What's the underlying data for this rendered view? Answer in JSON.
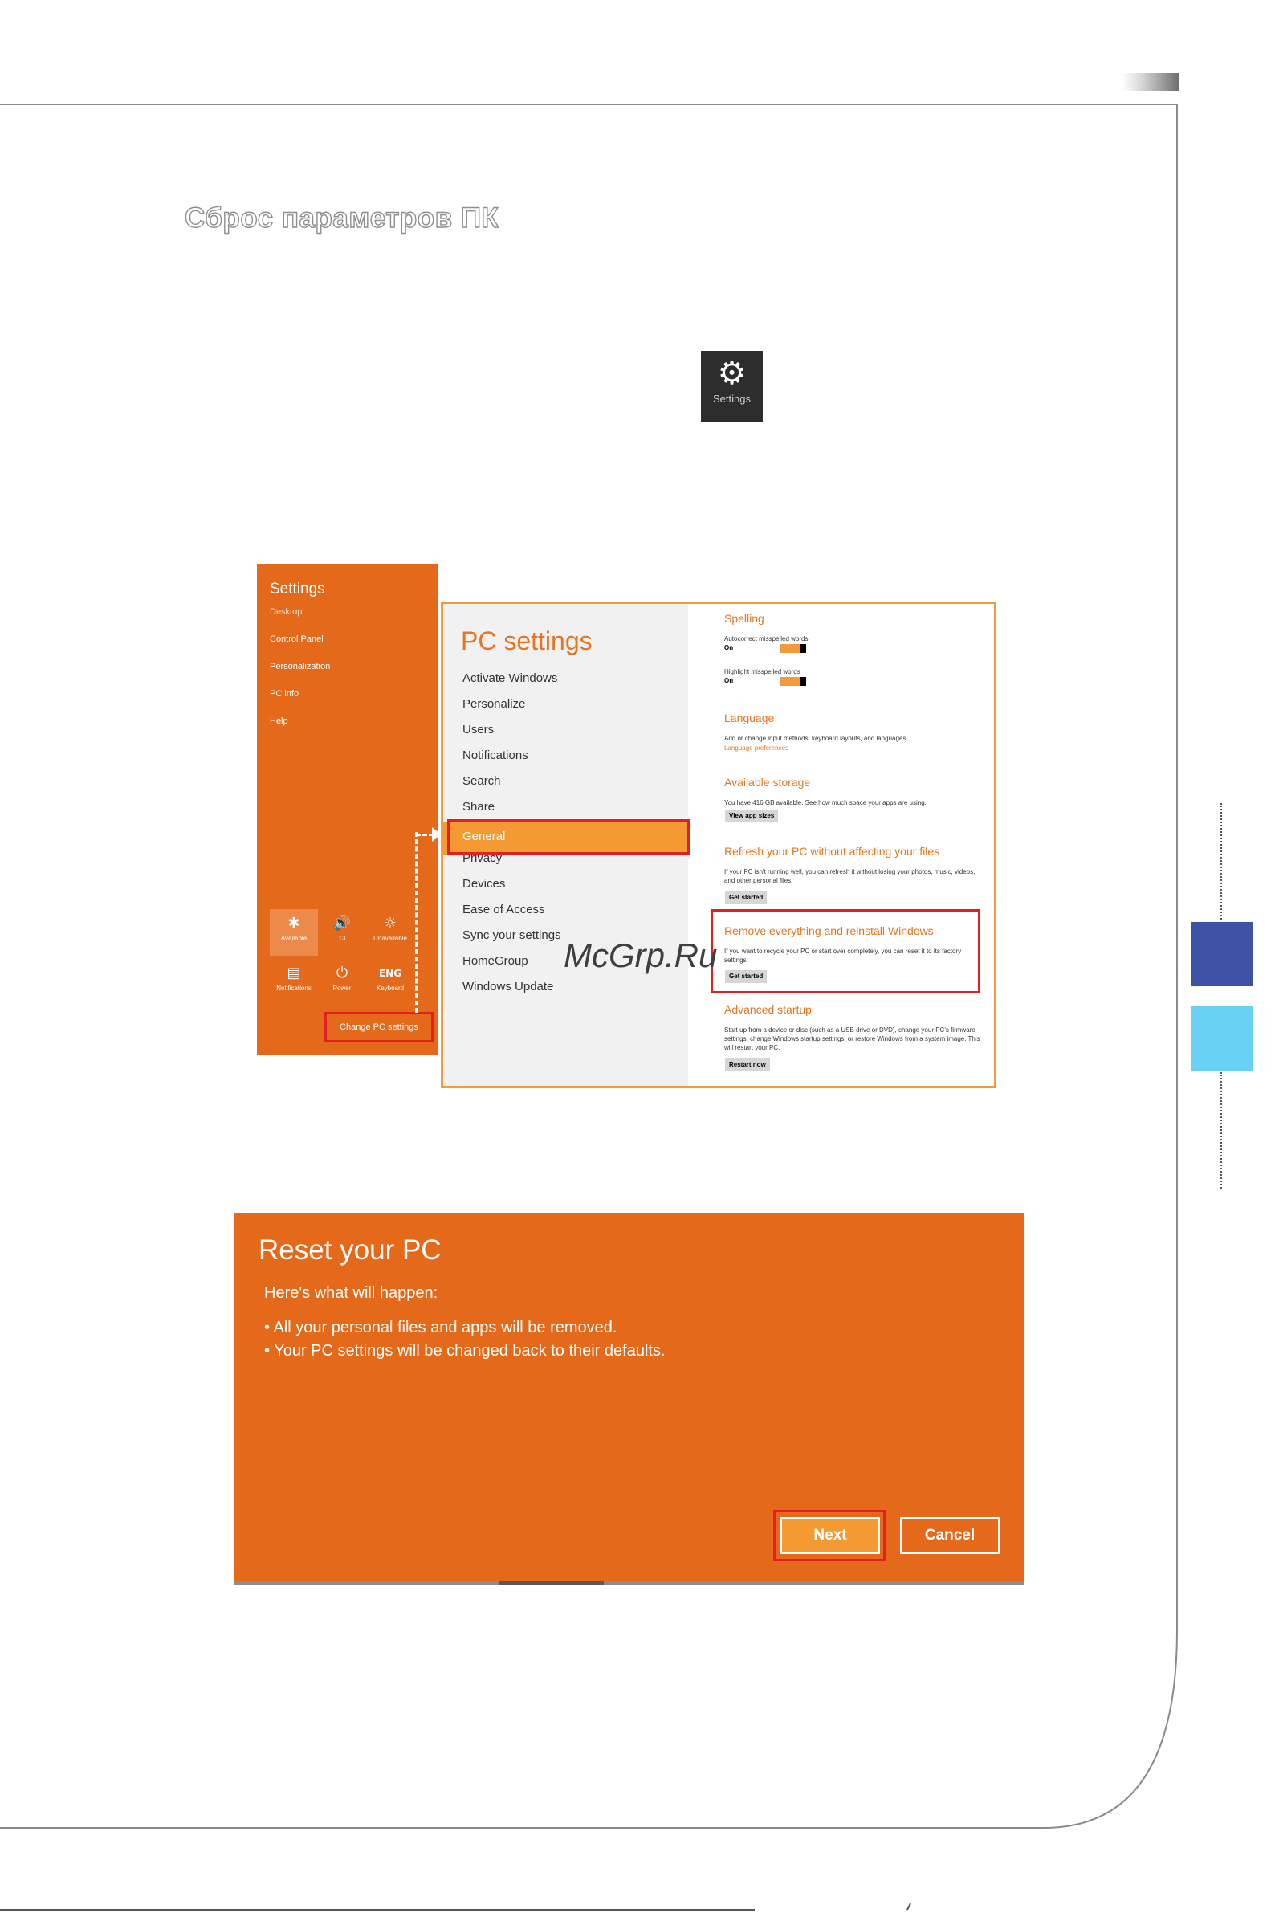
{
  "document": {
    "section_title": "Сброс параметров ПК"
  },
  "settings_icon": {
    "label": "Settings"
  },
  "charm_panel": {
    "title": "Settings",
    "items": [
      "Desktop",
      "Control Panel",
      "Personalization",
      "PC info",
      "Help"
    ],
    "quick_icons": [
      {
        "label": "Available"
      },
      {
        "label": "13"
      },
      {
        "label": "Unavailable"
      },
      {
        "label": "Notifications"
      },
      {
        "label": "Power"
      },
      {
        "label": "ENG",
        "sub": "Keyboard"
      }
    ],
    "change_button": "Change PC settings"
  },
  "pc_settings": {
    "title": "PC settings",
    "nav": [
      "Activate Windows",
      "Personalize",
      "Users",
      "Notifications",
      "Search",
      "Share",
      "General",
      "Privacy",
      "Devices",
      "Ease of Access",
      "Sync your settings",
      "HomeGroup",
      "Windows Update"
    ],
    "spelling": {
      "heading": "Spelling",
      "autocorrect_label": "Autocorrect misspelled words",
      "autocorrect_value": "On",
      "highlight_label": "Highlight misspelled words",
      "highlight_value": "On"
    },
    "language": {
      "heading": "Language",
      "text": "Add or change input methods, keyboard layouts, and languages.",
      "link": "Language preferences"
    },
    "storage": {
      "heading": "Available storage",
      "text": "You have 416 GB available. See how much space your apps are using.",
      "button": "View app sizes"
    },
    "refresh": {
      "heading": "Refresh your PC without affecting your files",
      "text": "If your PC isn't running well, you can refresh it without losing your photos, music, videos, and other personal files.",
      "button": "Get started"
    },
    "remove": {
      "heading": "Remove everything and reinstall Windows",
      "text": "If you want to recycle your PC or start over completely, you can reset it to its factory settings.",
      "button": "Get started"
    },
    "advanced": {
      "heading": "Advanced startup",
      "text": "Start up from a device or disc (such as a USB drive or DVD), change your PC's firmware settings, change Windows startup settings, or restore Windows from a system image. This will restart your PC.",
      "button": "Restart now"
    }
  },
  "watermark": "McGrp.Ru",
  "reset_dialog": {
    "title": "Reset your PC",
    "subtitle": "Here's what will happen:",
    "bullets": [
      "• All your personal files and apps will be removed.",
      "• Your PC settings will be changed back to their defaults."
    ],
    "next_label": "Next",
    "cancel_label": "Cancel"
  },
  "colors": {
    "orange": "#e5691b",
    "accent_orange": "#f39a33",
    "highlight_red": "#e41f23",
    "side_blue": "#3d52a5",
    "side_cyan": "#68d1f4"
  }
}
